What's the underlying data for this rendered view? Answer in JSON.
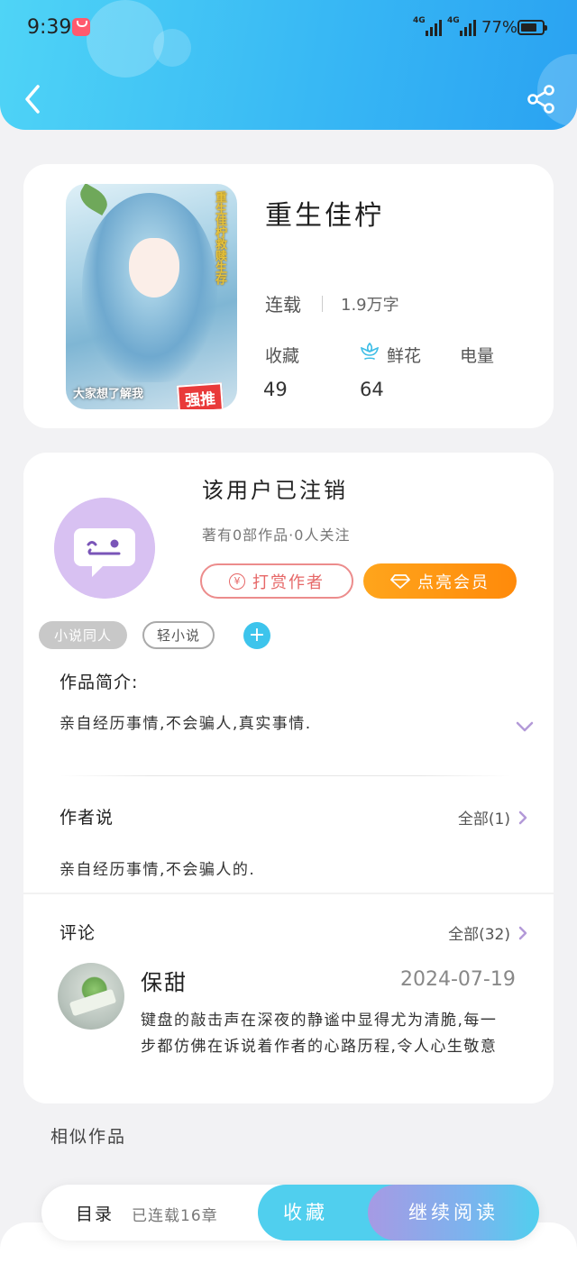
{
  "status_bar": {
    "time": "9:39",
    "signal1_label": "4G",
    "signal2_label": "4G",
    "battery_percent": "77%",
    "battery_level": 0.77
  },
  "header": {
    "back_icon": "chevron-left-icon",
    "share_icon": "share-icon",
    "gradient_start": "#4fd4f6",
    "gradient_end": "#2aa2f2"
  },
  "book": {
    "title": "重生佳柠",
    "status": "连载",
    "word_count": "1.9万字",
    "cover": {
      "vertical_text": "重生佳柠救赎生存",
      "tagline": "大家想了解我",
      "badge": "强推"
    },
    "stats": [
      {
        "label": "收藏",
        "value": "49"
      },
      {
        "label": "鲜花",
        "value": "64",
        "icon": "flower-icon"
      },
      {
        "label": "电量",
        "value": ""
      }
    ]
  },
  "author": {
    "name": "该用户已注销",
    "meta": "著有0部作品·0人关注",
    "reward_label": "打赏作者",
    "vip_label": "点亮会员",
    "accent_orange": "#ff8a0a"
  },
  "tags": [
    {
      "label": "小说同人"
    },
    {
      "label": "轻小说"
    }
  ],
  "add_tag_label": "+",
  "synopsis": {
    "title": "作品简介:",
    "text": "亲自经历事情,不会骗人,真实事情."
  },
  "author_says": {
    "title": "作者说",
    "see_all": "全部(1)",
    "text": "亲自经历事情,不会骗人的."
  },
  "comments": {
    "title": "评论",
    "see_all": "全部(32)",
    "items": [
      {
        "user": "保甜",
        "date": "2024-07-19",
        "text": "键盘的敲击声在深夜的静谧中显得尤为清脆,每一步都仿佛在诉说着作者的心路历程,令人心生敬意"
      }
    ]
  },
  "similar_title": "相似作品",
  "bottom_bar": {
    "toc_label": "目录",
    "chapters_label": "已连载16章",
    "collect_label": "收藏",
    "continue_label": "继续阅读"
  }
}
